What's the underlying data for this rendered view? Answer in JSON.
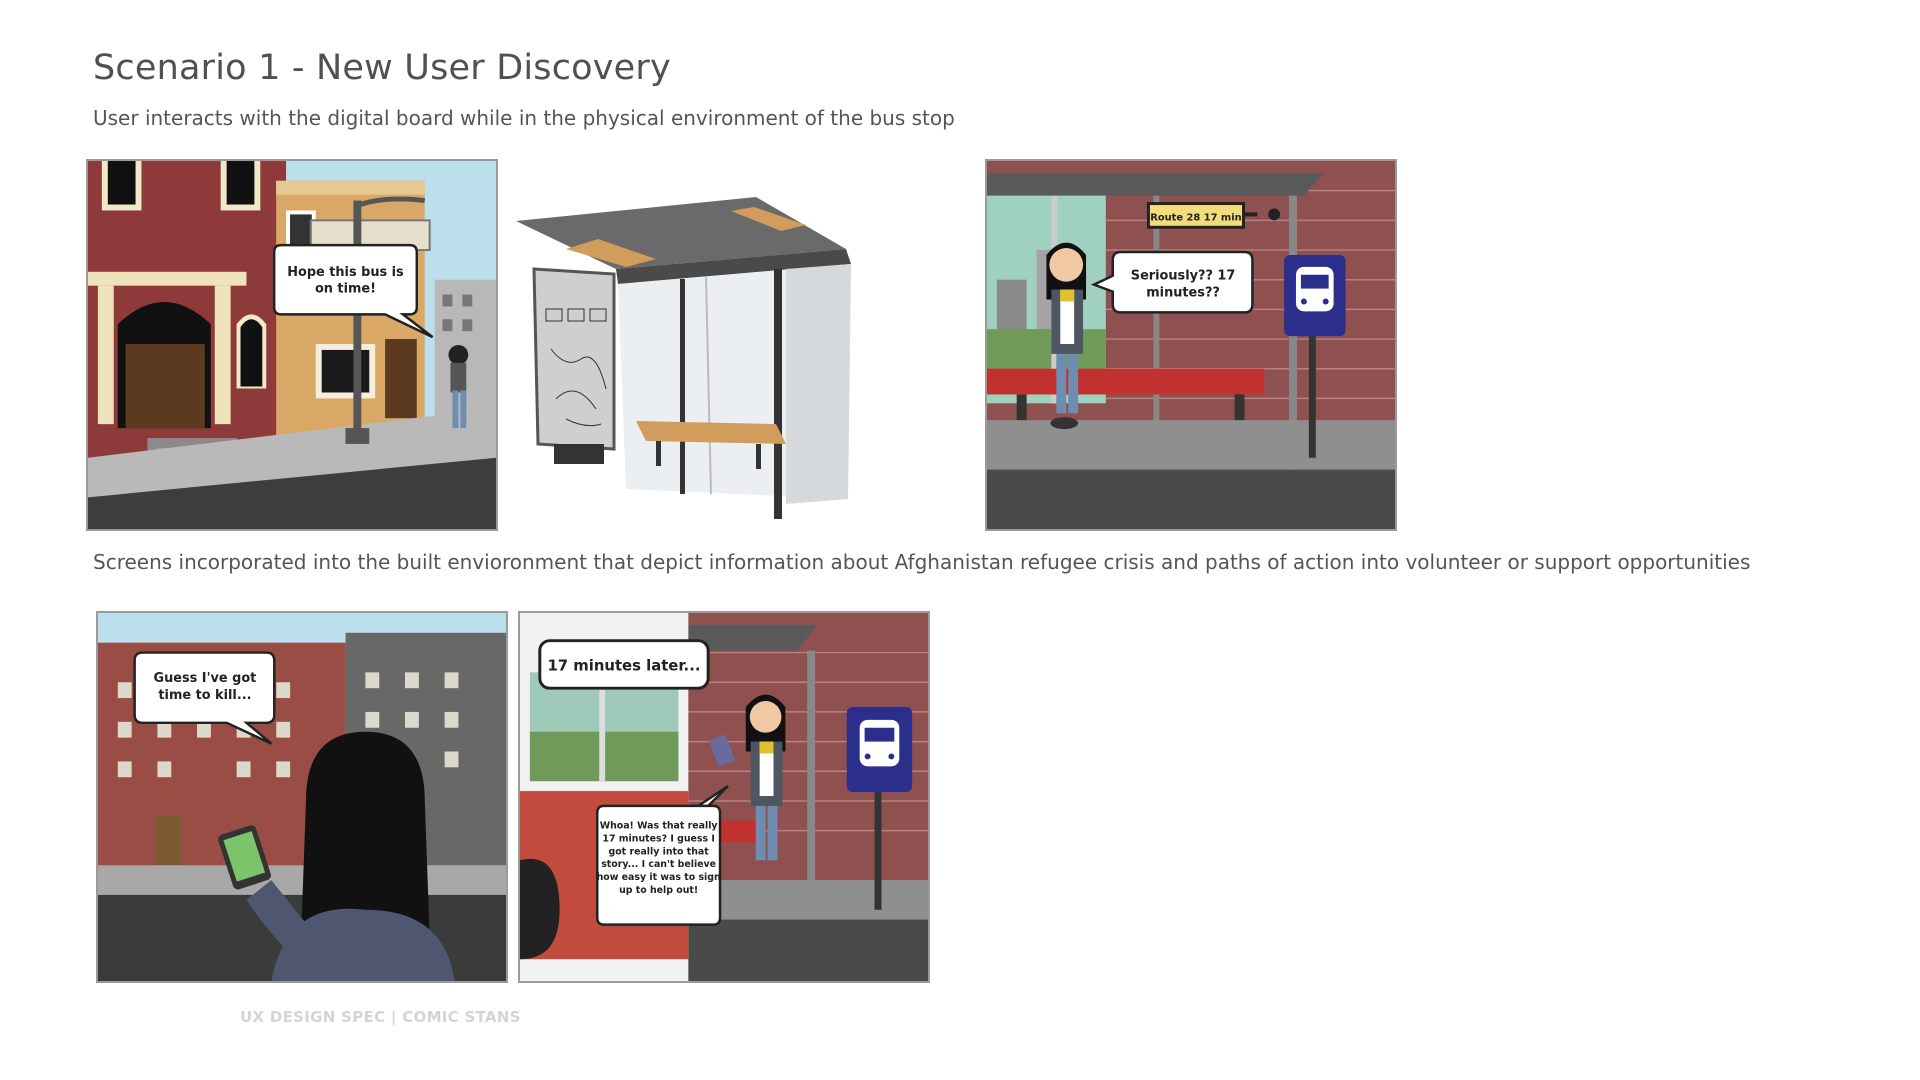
{
  "header": {
    "title": "Scenario 1 - New User Discovery",
    "subtitle": "User interacts with the digital board while in the physical environment of the bus stop"
  },
  "section2": {
    "description": "Screens incorporated into the built envioronment that depict information about Afghanistan refugee crisis and paths of action into volunteer or support opportunities"
  },
  "panels": {
    "p1": {
      "bubble_line1": "Hope this bus is",
      "bubble_line2": "on time!"
    },
    "p3": {
      "sign": "Route 28   17 min",
      "bubble_line1": "Seriously?? 17",
      "bubble_line2": "minutes??"
    },
    "p4": {
      "bubble_line1": "Guess I've got",
      "bubble_line2": "time to kill..."
    },
    "p5": {
      "caption": "17 minutes later...",
      "bubble_lines": [
        "Whoa! Was that really",
        "17 minutes? I guess I",
        "got really into that",
        "story... I can't believe",
        "how easy it was to sign",
        "up to help out!"
      ]
    }
  },
  "footer": {
    "text": "UX DESIGN SPEC  |  COMIC STANS"
  },
  "colors": {
    "brick": "#8f3a3a",
    "bus_sign": "#2c2e8c",
    "bench_red": "#c0312f",
    "sky": "#bcdfee"
  }
}
